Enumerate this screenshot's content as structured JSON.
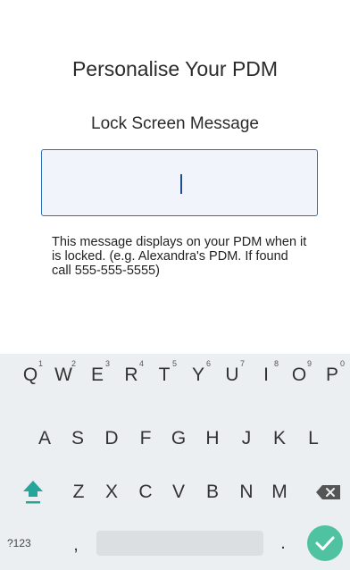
{
  "page": {
    "title": "Personalise Your PDM",
    "subtitle": "Lock Screen Message",
    "input": {
      "value": ""
    },
    "help_text": "This message displays on your PDM when it is locked. (e.g. Alexandra's PDM. If found call 555-555-5555)"
  },
  "keyboard": {
    "row1": [
      {
        "label": "Q",
        "hint": "1"
      },
      {
        "label": "W",
        "hint": "2"
      },
      {
        "label": "E",
        "hint": "3"
      },
      {
        "label": "R",
        "hint": "4"
      },
      {
        "label": "T",
        "hint": "5"
      },
      {
        "label": "Y",
        "hint": "6"
      },
      {
        "label": "U",
        "hint": "7"
      },
      {
        "label": "I",
        "hint": "8"
      },
      {
        "label": "O",
        "hint": "9"
      },
      {
        "label": "P",
        "hint": "0"
      }
    ],
    "row2": [
      "A",
      "S",
      "D",
      "F",
      "G",
      "H",
      "J",
      "K",
      "L"
    ],
    "row3": [
      "Z",
      "X",
      "C",
      "V",
      "B",
      "N",
      "M"
    ],
    "row4": {
      "symbols_label": "?123",
      "comma_label": ",",
      "period_label": "."
    },
    "shift_icon": "shift-arrow-up",
    "delete_icon": "backspace",
    "enter_icon": "checkmark",
    "colors": {
      "accent": "#2f6fb3",
      "enter": "#4fc3a1",
      "shift": "#26a69a",
      "keyboard_bg": "#eceff1"
    }
  }
}
